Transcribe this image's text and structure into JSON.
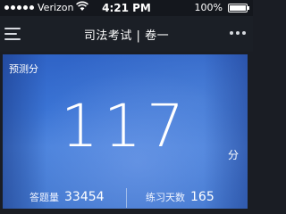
{
  "status_bar": {
    "carrier": "Verizon",
    "time": "4:21 PM",
    "battery": "100%",
    "battery_level_percent": 100
  },
  "nav": {
    "title": "司法考试 | 卷一",
    "menu_icon": "menu-icon",
    "more_icon": "more-icon"
  },
  "card": {
    "label": "预测分",
    "score": "117",
    "unit": "分",
    "stats": {
      "answered_label": "答题量",
      "answered_value": "33454",
      "days_label": "练习天数",
      "days_value": "165"
    }
  },
  "colors": {
    "nav_background": "#1b1f26",
    "card_blue": "#3a73d4"
  }
}
